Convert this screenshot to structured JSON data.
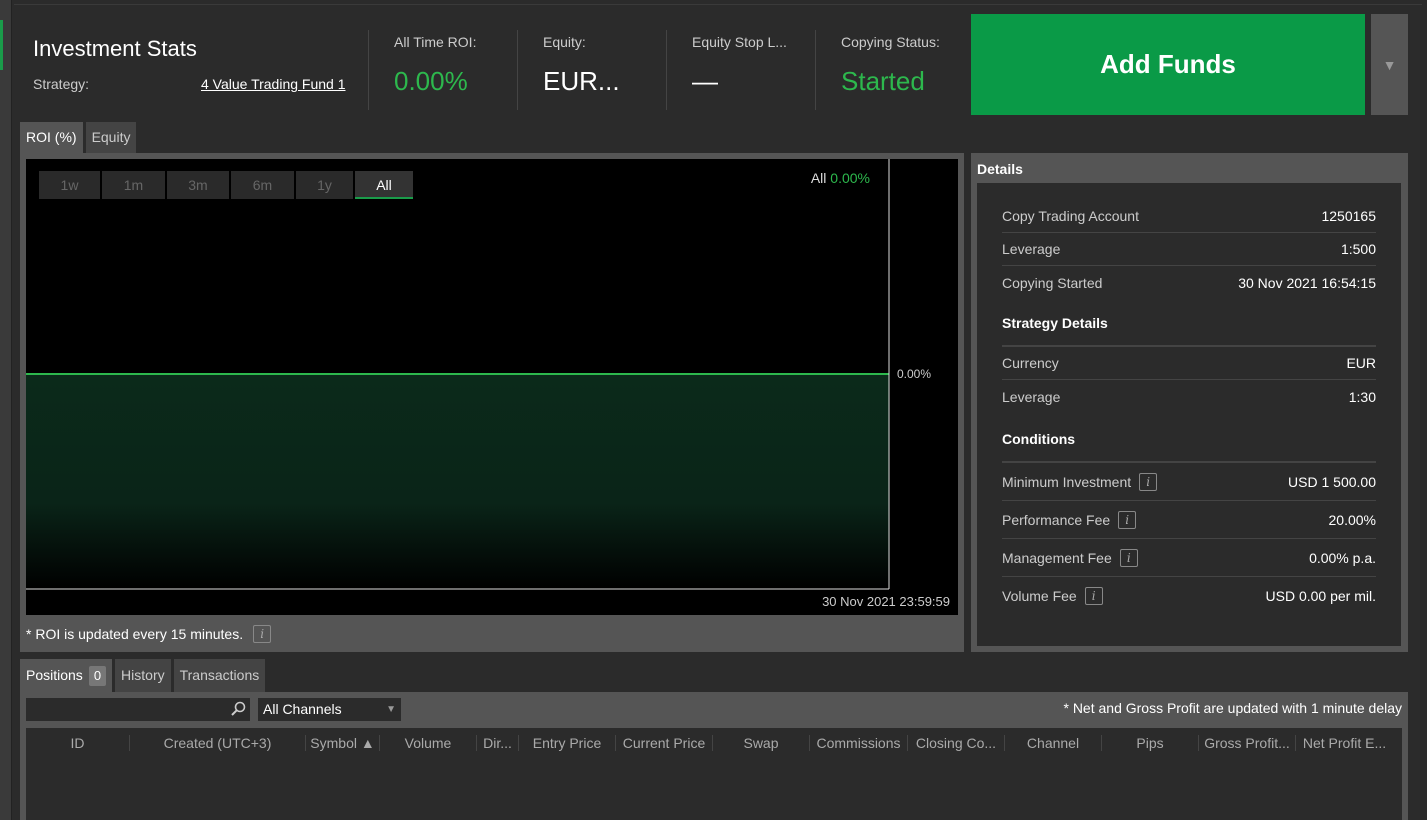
{
  "header": {
    "title": "Investment Stats",
    "strategy_label": "Strategy:",
    "strategy_name": "4 Value Trading Fund 1",
    "stats": [
      {
        "label": "All Time ROI:",
        "value": "0.00%"
      },
      {
        "label": "Equity:",
        "value": "EUR..."
      },
      {
        "label": "Equity Stop L...",
        "value": "—"
      },
      {
        "label": "Copying Status:",
        "value": "Started"
      }
    ],
    "add_funds_label": "Add Funds",
    "dropdown_glyph": "▼"
  },
  "chart_tabs": [
    "ROI (%)",
    "Equity"
  ],
  "chart": {
    "ranges": [
      "1w",
      "1m",
      "3m",
      "6m",
      "1y",
      "All"
    ],
    "active_range": "All",
    "all_label": "All",
    "all_value": "0.00%",
    "ytick": "0.00%",
    "xlabel": "30 Nov 2021 23:59:59",
    "footnote": "* ROI is updated every 15 minutes.",
    "info_glyph": "i"
  },
  "chart_data": {
    "type": "area",
    "x": [
      "30 Nov 2021 23:59:59"
    ],
    "series": [
      {
        "values": [
          0.0
        ]
      }
    ],
    "ylabel": "",
    "xlabel": ""
  },
  "details": {
    "title": "Details",
    "rows": [
      {
        "label": "Copy Trading Account",
        "value": "1250165"
      },
      {
        "label": "Leverage",
        "value": "1:500"
      },
      {
        "label": "Copying Started",
        "value": "30 Nov 2021 16:54:15"
      }
    ],
    "strategy_title": "Strategy Details",
    "strategy_rows": [
      {
        "label": "Currency",
        "value": "EUR"
      },
      {
        "label": "Leverage",
        "value": "1:30"
      }
    ],
    "conditions_title": "Conditions",
    "condition_rows": [
      {
        "label": "Minimum Investment",
        "value": "USD 1 500.00"
      },
      {
        "label": "Performance Fee",
        "value": "20.00%"
      },
      {
        "label": "Management Fee",
        "value": "0.00% p.a."
      },
      {
        "label": "Volume Fee",
        "value": "USD 0.00 per mil."
      }
    ]
  },
  "bottom_tabs": {
    "positions": "Positions",
    "positions_count": "0",
    "history": "History",
    "transactions": "Transactions"
  },
  "filters": {
    "search_placeholder": "",
    "channel": "All Channels",
    "delay_note": "* Net and Gross Profit are updated with 1 minute delay"
  },
  "table": {
    "columns": [
      "ID",
      "Created (UTC+3)",
      "Symbol ▲",
      "Volume",
      "Dir...",
      "Entry Price",
      "Current Price",
      "Swap",
      "Commissions",
      "Closing Co...",
      "Channel",
      "Pips",
      "Gross Profit...",
      "Net Profit E..."
    ]
  },
  "colors": {
    "accent_green": "#2db84d",
    "button_green": "#0a9a47"
  }
}
